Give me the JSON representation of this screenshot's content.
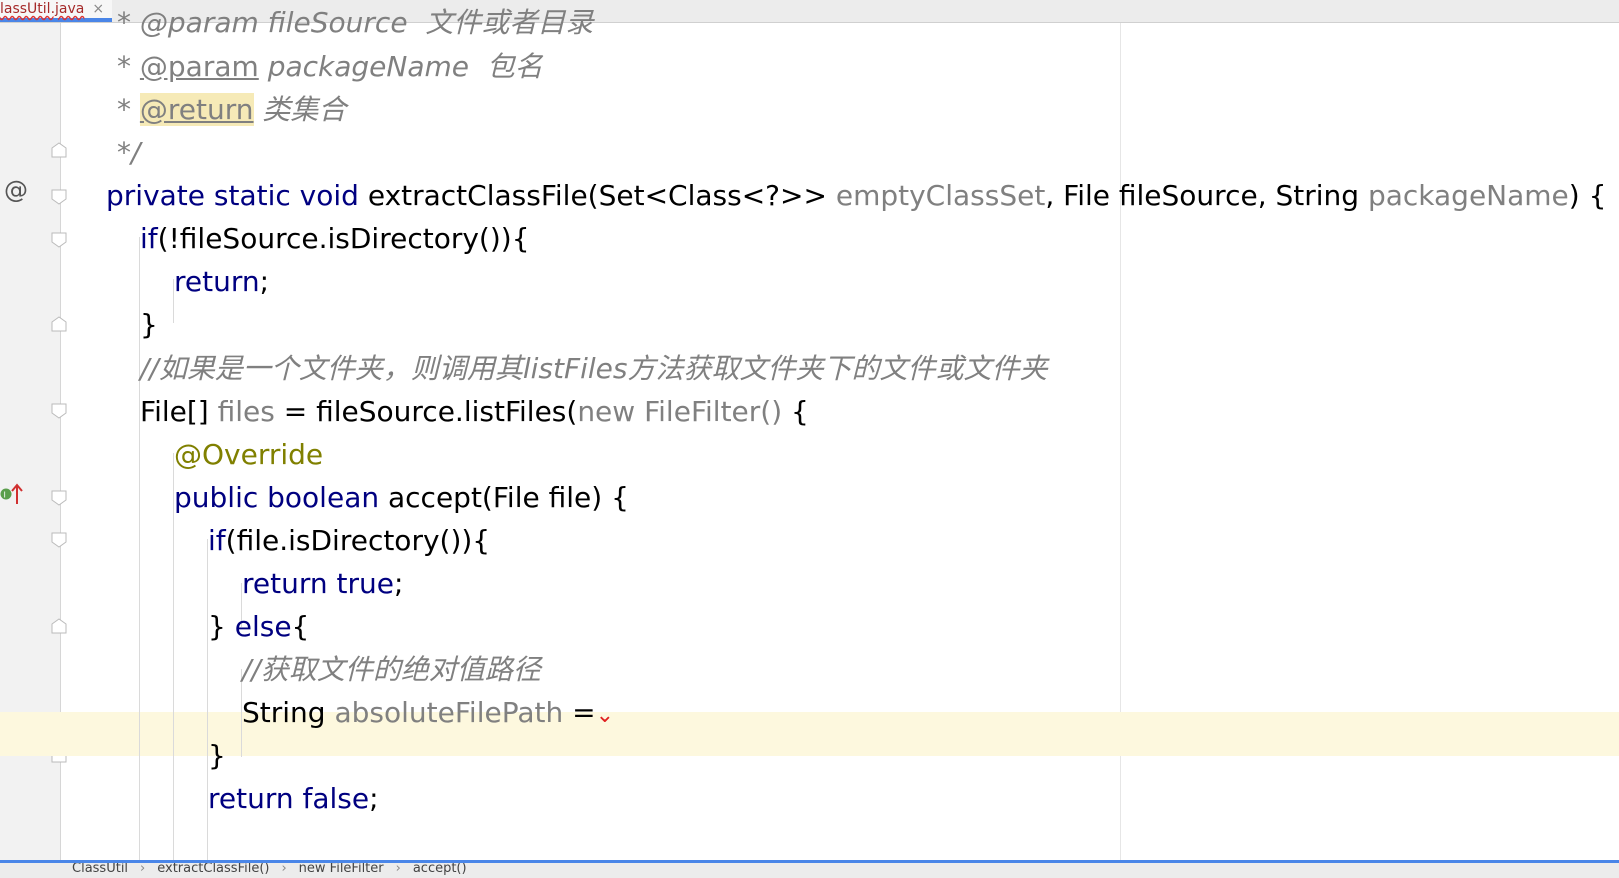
{
  "tab": {
    "label": "lassUtil.java",
    "close": "×"
  },
  "gutter": {
    "override_marker": "@"
  },
  "code": {
    "l0": "* @param fileSource  文件或者目录",
    "l1_star": "*",
    "l1_tag": "@param",
    "l1_text": " packageName  包名",
    "l2_star": "*",
    "l2_tag": "@return",
    "l2_text": " 类集合",
    "l3": "*/",
    "l4_kw": "private static void",
    "l4_a": " extractClassFile(Set<Class<?>> ",
    "l4_p1": "emptyClassSet",
    "l4_b": ", File fileSource, String ",
    "l4_p2": "packageName",
    "l4_c": ") {",
    "l5_kw": "if",
    "l5_a": "(!fileSource.isDirectory()){",
    "l6_kw": "return",
    "l6_a": ";",
    "l7": "}",
    "l8": "//如果是一个文件夹，则调用其listFiles方法获取文件夹下的文件或文件夹",
    "l9_a": "File[] ",
    "l9_v": "files",
    "l9_b": " = fileSource.listFiles(",
    "l9_anon": "new FileFilter()",
    "l9_c": " {",
    "l10": "@Override",
    "l11_kw": "public boolean",
    "l11_a": " accept(File file) {",
    "l12_kw": "if",
    "l12_a": "(file.isDirectory()){",
    "l13_kw": "return true",
    "l13_a": ";",
    "l14_a": "} ",
    "l14_kw": "else",
    "l14_b": "{",
    "l15": "//获取文件的绝对值路径",
    "l16_a": "String ",
    "l16_v": "absoluteFilePath",
    "l16_b": " =",
    "l17": "}",
    "l18_kw": "return false",
    "l18_a": ";"
  },
  "breadcrumb": [
    "ClassUtil",
    "extractClassFile()",
    "new FileFilter",
    "accept()"
  ],
  "breadcrumb_sep": "›"
}
